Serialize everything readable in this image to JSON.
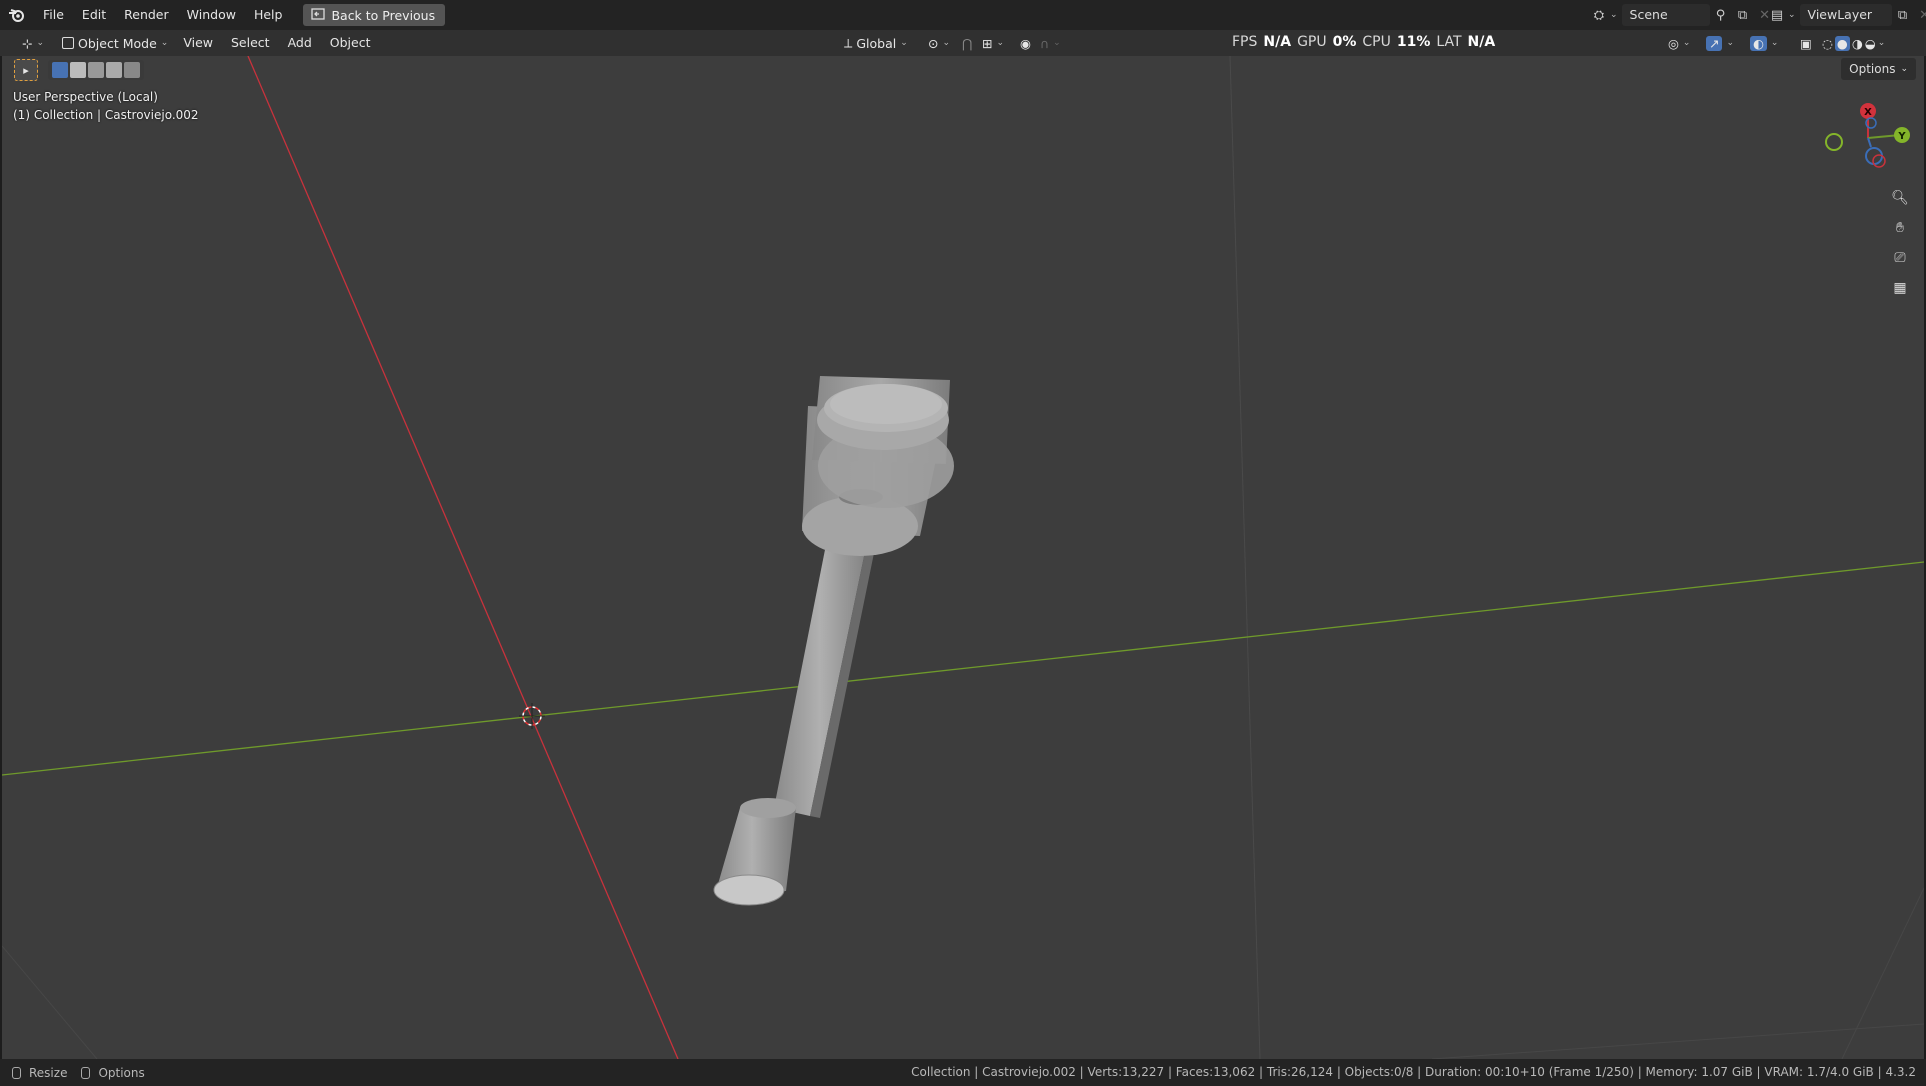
{
  "menu": {
    "items": [
      "File",
      "Edit",
      "Render",
      "Window",
      "Help"
    ],
    "back_button": "Back to Previous"
  },
  "scene": {
    "name": "Scene",
    "view_layer": "ViewLayer"
  },
  "header": {
    "mode": "Object Mode",
    "menus": [
      "View",
      "Select",
      "Add",
      "Object"
    ],
    "transform_orientation": "Global"
  },
  "stats": {
    "fps_label": "FPS",
    "fps_value": "N/A",
    "gpu_label": "GPU",
    "gpu_value": "0%",
    "cpu_label": "CPU",
    "cpu_value": "11%",
    "lat_label": "LAT",
    "lat_value": "N/A"
  },
  "viewport": {
    "perspective": "User Perspective (Local)",
    "collection_info": "(1) Collection | Castroviejo.002",
    "options_label": "Options"
  },
  "gizmo": {
    "x": "X",
    "y": "Y"
  },
  "status": {
    "left": [
      "Resize",
      "Options"
    ],
    "right": "Collection | Castroviejo.002 | Verts:13,227 | Faces:13,062 | Tris:26,124 | Objects:0/8 | Duration: 00:10+10 (Frame 1/250) | Memory: 1.07 GiB | VRAM: 1.7/4.0 GiB | 4.3.2"
  },
  "colors": {
    "x_axis": "#c8323c",
    "y_axis": "#6f9a2b",
    "viewport_bg": "#3d3d3d",
    "object": "#9a9a9a"
  }
}
